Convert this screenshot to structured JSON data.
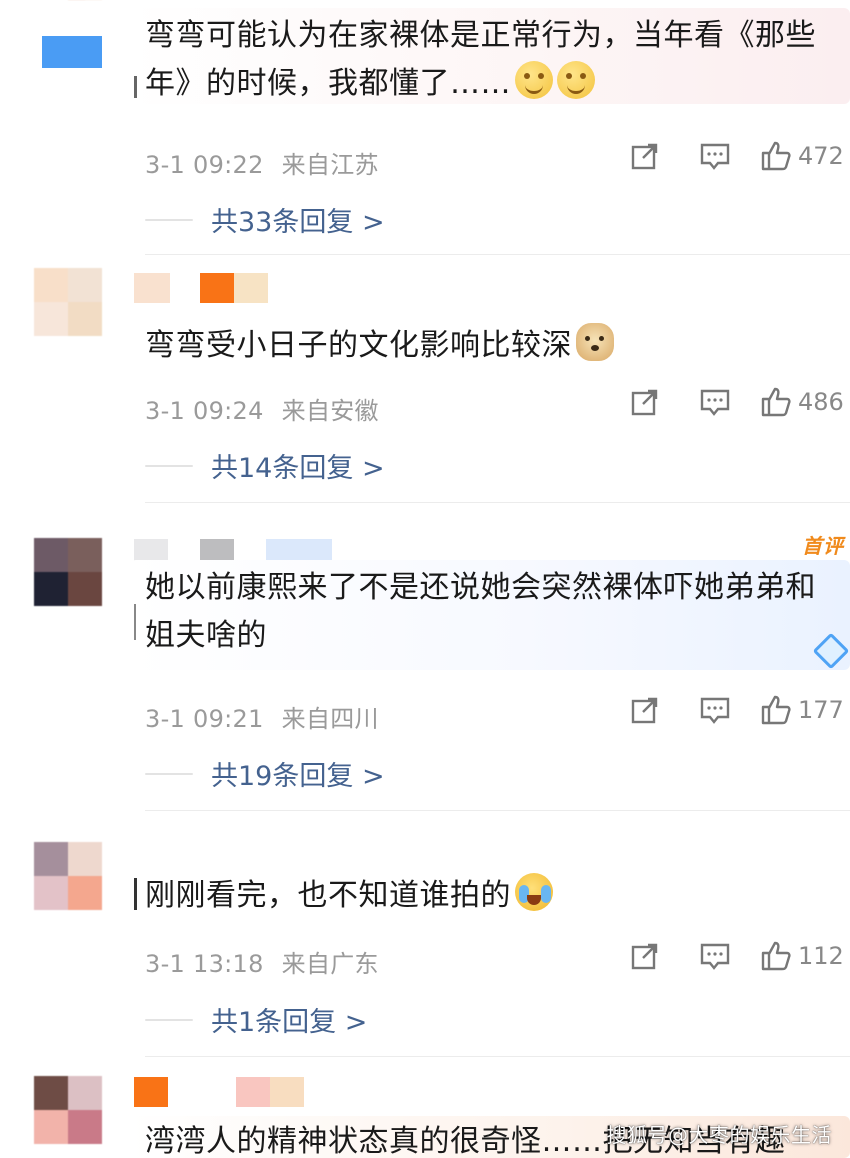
{
  "colors": {
    "reply_link": "#44628f",
    "meta_gray": "#9a9a9a",
    "first_badge": "#f08a1c",
    "accent_blue": "#2a8bf2"
  },
  "comments": [
    {
      "text": "弯弯可能认为在家裸体是正常行为，当年看《那些年》的时候，我都懂了……",
      "emojis": [
        "smile-emoji",
        "smile-emoji"
      ],
      "time": "3-1 09:22",
      "location": "来自江苏",
      "likes": "472",
      "replies": "共33条回复 >"
    },
    {
      "text": "弯弯受小日子的文化影响比较深",
      "emojis": [
        "doge-emoji"
      ],
      "time": "3-1 09:24",
      "location": "来自安徽",
      "likes": "486",
      "replies": "共14条回复 >"
    },
    {
      "badge": "首评",
      "text": "她以前康熙来了不是还说她会突然裸体吓她弟弟和姐夫啥的",
      "time": "3-1 09:21",
      "location": "来自四川",
      "likes": "177",
      "replies": "共19条回复 >"
    },
    {
      "text": "刚刚看完，也不知道谁拍的",
      "emojis": [
        "cry-laugh-emoji"
      ],
      "time": "3-1 13:18",
      "location": "来自广东",
      "likes": "112",
      "replies": "共1条回复 >"
    },
    {
      "text": "湾湾人的精神状态真的很奇怪……把无知当有趣"
    }
  ],
  "watermark": "搜狐号@大枣的娱乐生活",
  "icons": {
    "share": "share-icon",
    "comment": "comment-icon",
    "like": "thumbs-up-icon"
  }
}
